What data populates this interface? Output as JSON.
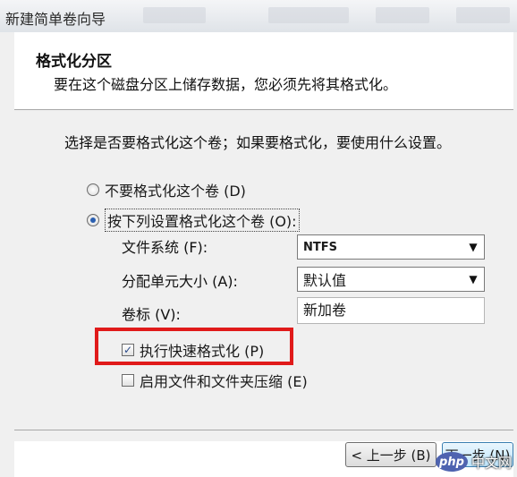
{
  "window": {
    "title": "新建简单卷向导"
  },
  "header": {
    "title": "格式化分区",
    "subtitle": "要在这个磁盘分区上储存数据，您必须先将其格式化。"
  },
  "prompt": "选择是否要格式化这个卷；如果要格式化，要使用什么设置。",
  "options": {
    "no_format": {
      "label": "不要格式化这个卷 (D)",
      "selected": false
    },
    "format": {
      "label": "按下列设置格式化这个卷 (O):",
      "selected": true
    }
  },
  "fields": {
    "filesystem": {
      "label": "文件系统 (F):",
      "value": "NTFS"
    },
    "allocation": {
      "label": "分配单元大小 (A):",
      "value": "默认值"
    },
    "volume_label": {
      "label": "卷标 (V):",
      "value": "新加卷"
    }
  },
  "checks": {
    "quick_format": {
      "label": "执行快速格式化 (P)",
      "checked": true,
      "mark": "✓"
    },
    "compression": {
      "label": "启用文件和文件夹压缩 (E)",
      "checked": false
    }
  },
  "buttons": {
    "back": "< 上一步 (B)",
    "next": "下一步 (N)"
  },
  "watermark": {
    "logo": "php",
    "text": "中文网"
  },
  "colors": {
    "highlight": "#e01a1a",
    "accent": "#2a5fb0"
  }
}
